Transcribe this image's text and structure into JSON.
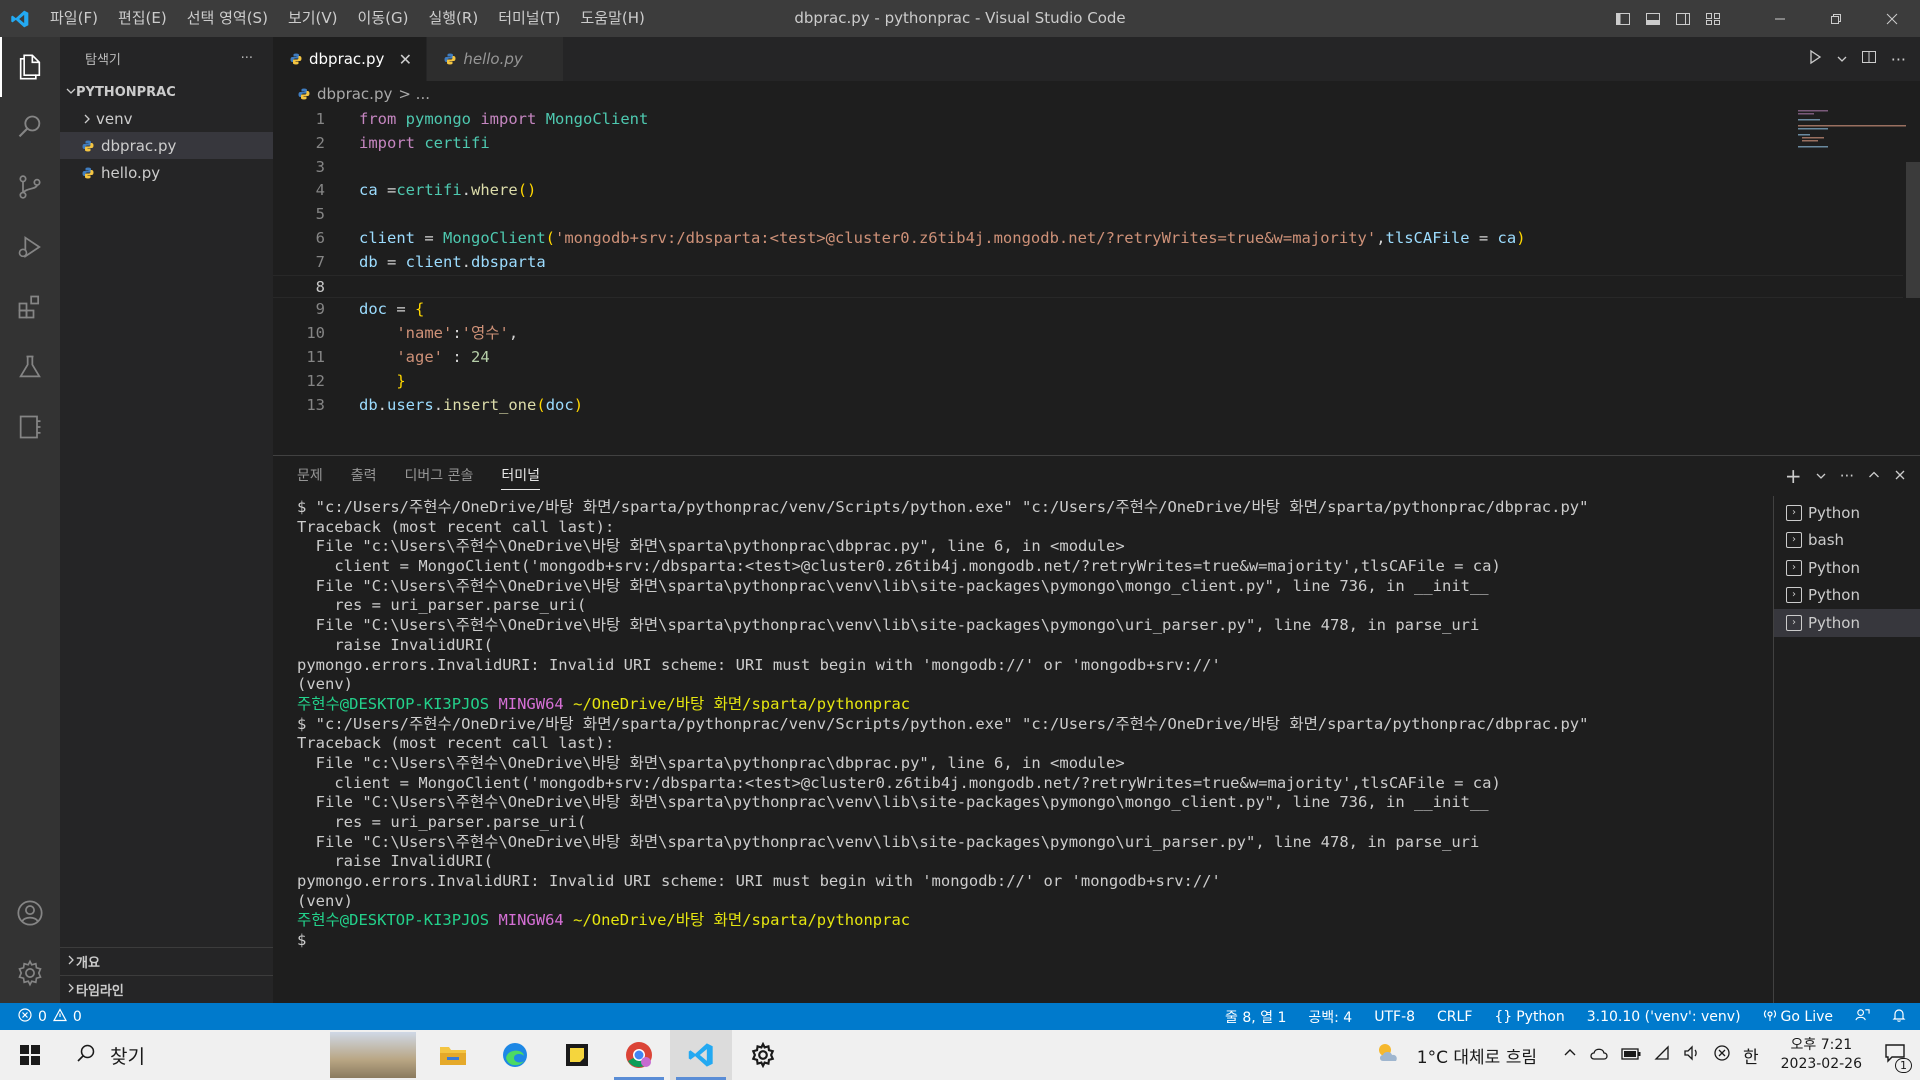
{
  "window": {
    "title": "dbprac.py - pythonprac - Visual Studio Code",
    "menu": [
      "파일(F)",
      "편집(E)",
      "선택 영역(S)",
      "보기(V)",
      "이동(G)",
      "실행(R)",
      "터미널(T)",
      "도움말(H)"
    ]
  },
  "sidebar": {
    "header": "탐색기",
    "more": "···",
    "project": "PYTHONPRAC",
    "items": [
      {
        "label": "venv",
        "type": "folder"
      },
      {
        "label": "dbprac.py",
        "type": "file"
      },
      {
        "label": "hello.py",
        "type": "file"
      }
    ],
    "outline": "개요",
    "timeline": "타임라인"
  },
  "tabs": [
    {
      "label": "dbprac.py",
      "active": true
    },
    {
      "label": "hello.py",
      "active": false
    }
  ],
  "breadcrumb": {
    "file": "dbprac.py",
    "rest": "> ..."
  },
  "editor": {
    "line_numbers": [
      "1",
      "2",
      "3",
      "4",
      "5",
      "6",
      "7",
      "8",
      "9",
      "10",
      "11",
      "12",
      "13"
    ],
    "current_line": 8
  },
  "panel": {
    "tabs": [
      "문제",
      "출력",
      "디버그 콘솔",
      "터미널"
    ],
    "active_tab": "터미널",
    "terminal_lines": [
      "$ \"c:/Users/주현수/OneDrive/바탕 화면/sparta/pythonprac/venv/Scripts/python.exe\" \"c:/Users/주현수/OneDrive/바탕 화면/sparta/pythonprac/dbprac.py\"",
      "Traceback (most recent call last):",
      "  File \"c:\\Users\\주현수\\OneDrive\\바탕 화면\\sparta\\pythonprac\\dbprac.py\", line 6, in <module>",
      "    client = MongoClient('mongodb+srv:/dbsparta:<test>@cluster0.z6tib4j.mongodb.net/?retryWrites=true&w=majority',tlsCAFile = ca)",
      "  File \"C:\\Users\\주현수\\OneDrive\\바탕 화면\\sparta\\pythonprac\\venv\\lib\\site-packages\\pymongo\\mongo_client.py\", line 736, in __init__",
      "    res = uri_parser.parse_uri(",
      "  File \"C:\\Users\\주현수\\OneDrive\\바탕 화면\\sparta\\pythonprac\\venv\\lib\\site-packages\\pymongo\\uri_parser.py\", line 478, in parse_uri",
      "    raise InvalidURI(",
      "pymongo.errors.InvalidURI: Invalid URI scheme: URI must begin with 'mongodb://' or 'mongodb+srv://'",
      "(venv) "
    ],
    "prompt_user": "주현수@DESKTOP-KI3PJOS",
    "prompt_shell": "MINGW64",
    "prompt_path": "~/OneDrive/바탕 화면/sparta/pythonprac",
    "final_prompt": "$",
    "terminals": [
      {
        "label": "Python",
        "selected": false
      },
      {
        "label": "bash",
        "selected": false
      },
      {
        "label": "Python",
        "selected": false
      },
      {
        "label": "Python",
        "selected": false
      },
      {
        "label": "Python",
        "selected": true
      }
    ]
  },
  "statusbar": {
    "errors": "0",
    "warnings": "0",
    "position": "줄 8, 열 1",
    "spaces": "공백: 4",
    "encoding": "UTF-8",
    "eol": "CRLF",
    "language": "Python",
    "interpreter": "3.10.10 ('venv': venv)",
    "golive": "Go Live"
  },
  "taskbar": {
    "search_placeholder": "찾기",
    "weather": "1°C  대체로 흐림",
    "ime": "한",
    "time": "오후 7:21",
    "date": "2023-02-26",
    "notification_count": "1"
  },
  "colors": {
    "accent": "#007acc",
    "prompt_green": "#23d18b",
    "prompt_magenta": "#d670d6",
    "prompt_yellow": "#e5e510"
  }
}
